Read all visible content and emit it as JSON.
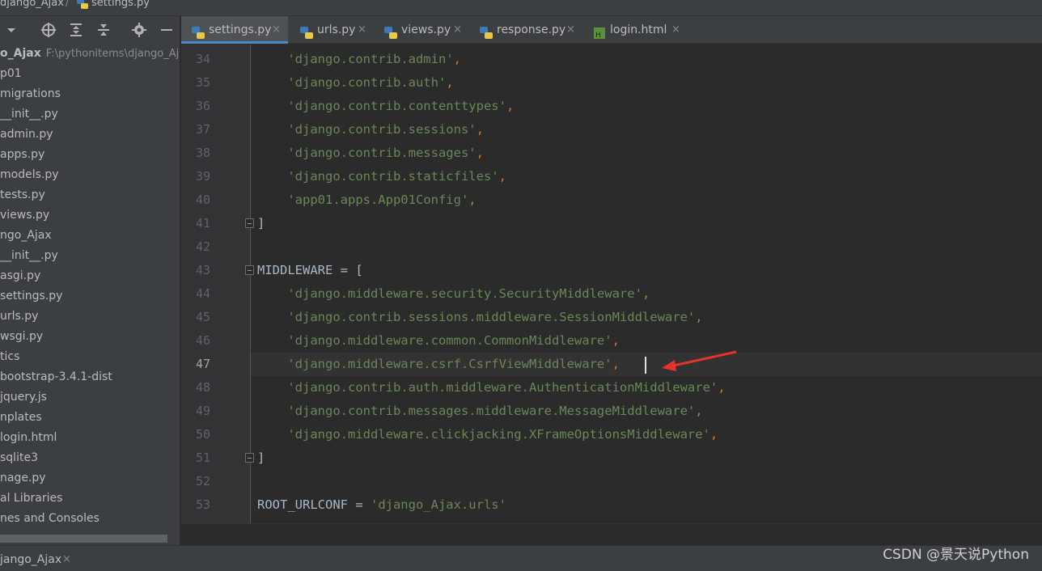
{
  "breadcrumb": {
    "project": "django_Ajax",
    "separator": "/",
    "file": "settings.py"
  },
  "sidebar": {
    "toolbar_icons": [
      "chevron-down-icon",
      "locate-icon",
      "expand-all-icon",
      "collapse-all-icon",
      "gear-icon",
      "minimize-icon"
    ],
    "root": {
      "name": "o_Ajax",
      "path": "F:\\pythonitems\\django_Aja"
    },
    "items": [
      {
        "label": "p01"
      },
      {
        "label": "migrations"
      },
      {
        "label": "__init__.py"
      },
      {
        "label": "admin.py"
      },
      {
        "label": "apps.py"
      },
      {
        "label": "models.py"
      },
      {
        "label": "tests.py"
      },
      {
        "label": "views.py"
      },
      {
        "label": "ngo_Ajax"
      },
      {
        "label": "__init__.py"
      },
      {
        "label": "asgi.py"
      },
      {
        "label": "settings.py"
      },
      {
        "label": "urls.py"
      },
      {
        "label": "wsgi.py"
      },
      {
        "label": "tics"
      },
      {
        "label": "bootstrap-3.4.1-dist"
      },
      {
        "label": "jquery.js"
      },
      {
        "label": "nplates"
      },
      {
        "label": "login.html"
      },
      {
        "label": "sqlite3"
      },
      {
        "label": "nage.py"
      },
      {
        "label": "al Libraries"
      },
      {
        "label": "nes and Consoles"
      }
    ]
  },
  "tabs": [
    {
      "label": "settings.py",
      "active": true,
      "icon": "python-file-icon"
    },
    {
      "label": "urls.py",
      "active": false,
      "icon": "python-file-icon"
    },
    {
      "label": "views.py",
      "active": false,
      "icon": "python-file-icon"
    },
    {
      "label": "response.py",
      "active": false,
      "icon": "python-file-icon"
    },
    {
      "label": "login.html",
      "active": false,
      "icon": "html-file-icon"
    }
  ],
  "tab_close_glyph": "×",
  "editor": {
    "current_line": "47",
    "lines": [
      {
        "num": "34",
        "indent": "    ",
        "str": "'django.contrib.admin'",
        "punc": ","
      },
      {
        "num": "35",
        "indent": "    ",
        "str": "'django.contrib.auth'",
        "punc": ","
      },
      {
        "num": "36",
        "indent": "    ",
        "str": "'django.contrib.contenttypes'",
        "punc": ","
      },
      {
        "num": "37",
        "indent": "    ",
        "str": "'django.contrib.sessions'",
        "punc": ","
      },
      {
        "num": "38",
        "indent": "    ",
        "str": "'django.contrib.messages'",
        "punc": ","
      },
      {
        "num": "39",
        "indent": "    ",
        "str": "'django.contrib.staticfiles'",
        "punc": ","
      },
      {
        "num": "40",
        "indent": "    ",
        "str": "'app01.apps.App01Config'",
        "punc": ","
      },
      {
        "num": "41",
        "indent": "",
        "ident": "]",
        "fold": true
      },
      {
        "num": "42",
        "indent": ""
      },
      {
        "num": "43",
        "indent": "",
        "ident": "MIDDLEWARE = [",
        "fold": true
      },
      {
        "num": "44",
        "indent": "    ",
        "str": "'django.middleware.security.SecurityMiddleware'",
        "punc": ","
      },
      {
        "num": "45",
        "indent": "    ",
        "str": "'django.contrib.sessions.middleware.SessionMiddleware'",
        "punc": ","
      },
      {
        "num": "46",
        "indent": "    ",
        "str": "'django.middleware.common.CommonMiddleware'",
        "punc": ","
      },
      {
        "num": "47",
        "indent": "    ",
        "str": "'django.middleware.csrf.CsrfViewMiddleware'",
        "punc": ","
      },
      {
        "num": "48",
        "indent": "    ",
        "str": "'django.contrib.auth.middleware.AuthenticationMiddleware'",
        "punc": ","
      },
      {
        "num": "49",
        "indent": "    ",
        "str": "'django.contrib.messages.middleware.MessageMiddleware'",
        "punc": ","
      },
      {
        "num": "50",
        "indent": "    ",
        "str": "'django.middleware.clickjacking.XFrameOptionsMiddleware'",
        "punc": ","
      },
      {
        "num": "51",
        "indent": "",
        "ident": "]",
        "fold": true
      },
      {
        "num": "52",
        "indent": ""
      },
      {
        "num": "53",
        "indent": "",
        "ident": "ROOT_URLCONF = ",
        "str": "'django_Ajax.urls'"
      }
    ]
  },
  "bottom_tab": {
    "label": "jango_Ajax",
    "close": "×"
  },
  "watermark": "CSDN @景天说Python",
  "colors": {
    "string": "#6a8759",
    "keyword_punct": "#cc7832",
    "identifier": "#a9b7c6",
    "annotation_arrow": "#e8322b",
    "active_tab_underline": "#4a88c7"
  }
}
